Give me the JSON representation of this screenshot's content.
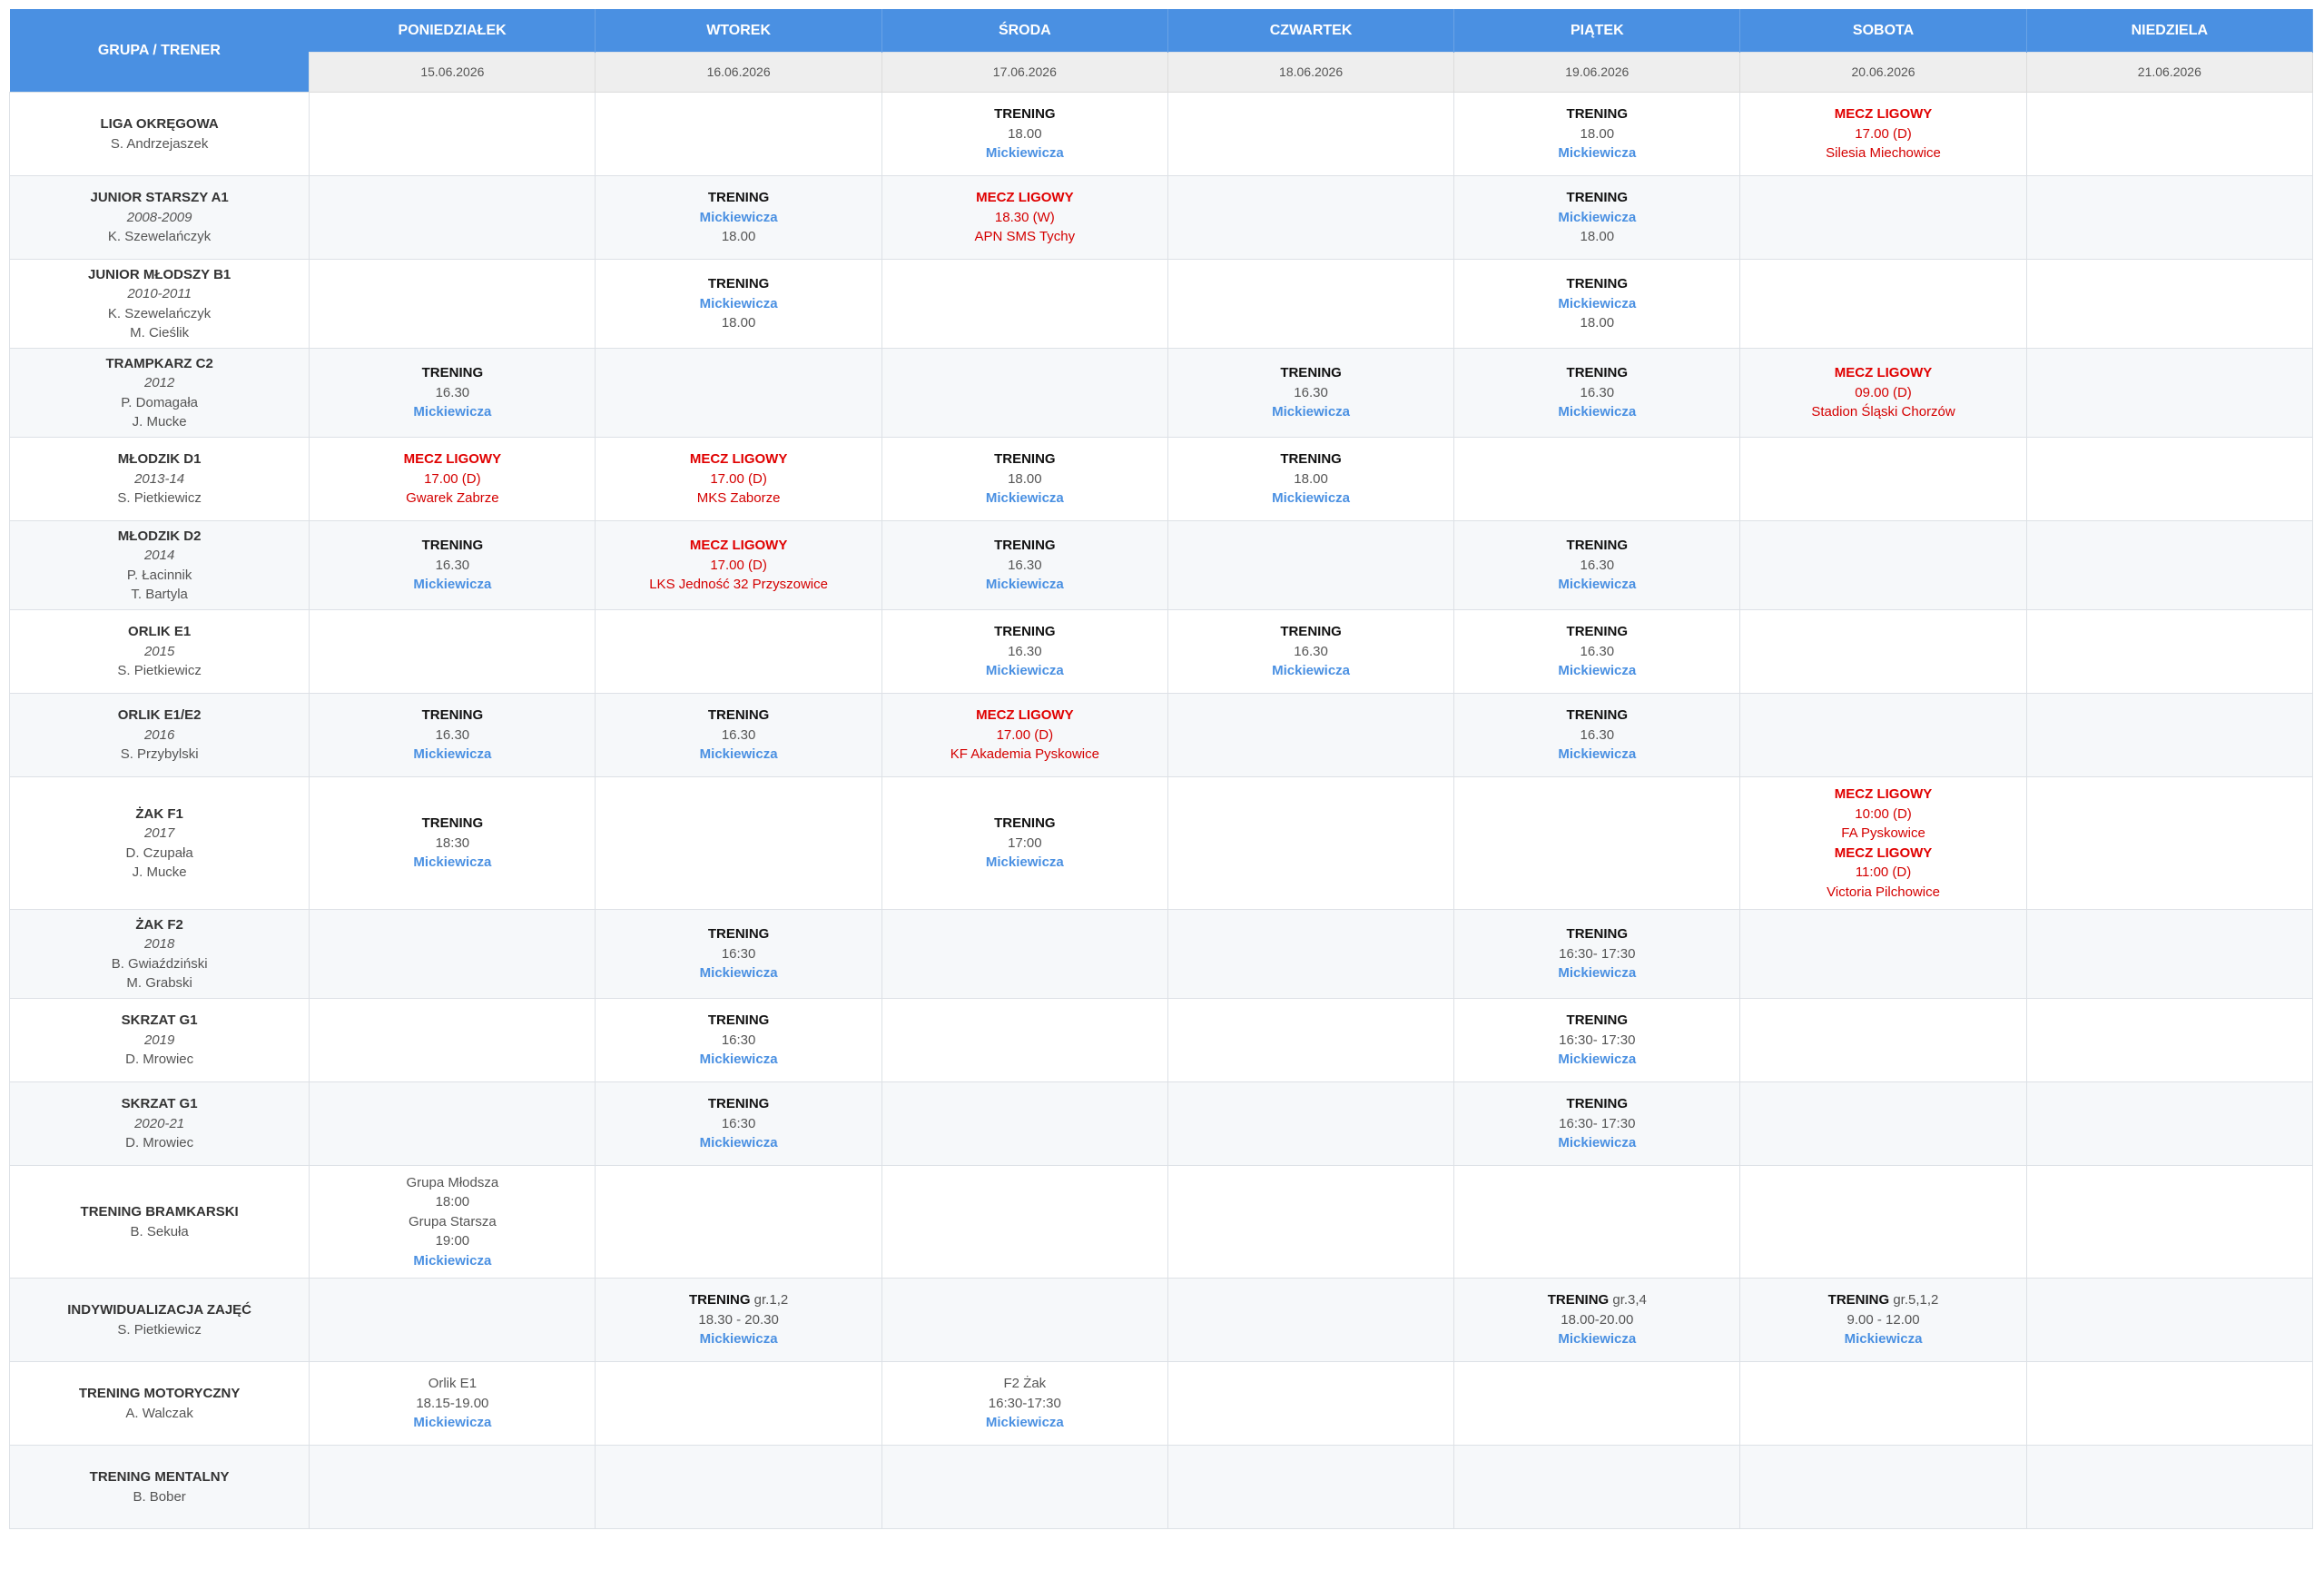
{
  "header": {
    "group_trainer": "GRUPA / TRENER",
    "days": [
      {
        "name": "PONIEDZIAŁEK",
        "date": "15.06.2026"
      },
      {
        "name": "WTOREK",
        "date": "16.06.2026"
      },
      {
        "name": "ŚRODA",
        "date": "17.06.2026"
      },
      {
        "name": "CZWARTEK",
        "date": "18.06.2026"
      },
      {
        "name": "PIĄTEK",
        "date": "19.06.2026"
      },
      {
        "name": "SOBOTA",
        "date": "20.06.2026"
      },
      {
        "name": "NIEDZIELA",
        "date": "21.06.2026"
      }
    ]
  },
  "labels": {
    "training": "TRENING",
    "league_match": "MECZ LIGOWY",
    "location": "Mickiewicza"
  },
  "colors": {
    "header_blue": "#4a90e2",
    "match_red": "#e00000",
    "location_blue": "#4a90e2"
  },
  "rows": [
    {
      "group": {
        "name": "LIGA OKRĘGOWA",
        "year": "",
        "coaches": [
          "S. Andrzejaszek"
        ]
      },
      "height": 92,
      "cells": [
        [],
        [],
        [
          {
            "kind": "training",
            "lines": [
              "18.00"
            ],
            "loc": true
          }
        ],
        [],
        [
          {
            "kind": "training",
            "lines": [
              "18.00"
            ],
            "loc": true
          }
        ],
        [
          {
            "kind": "match",
            "lines": [
              "17.00 (D)",
              "Silesia Miechowice"
            ]
          }
        ],
        []
      ]
    },
    {
      "group": {
        "name": "JUNIOR STARSZY A1",
        "year": "2008-2009",
        "coaches": [
          "K. Szewelańczyk"
        ]
      },
      "height": 92,
      "cells": [
        [],
        [
          {
            "kind": "training",
            "loc_first": true,
            "lines": [
              "18.00"
            ]
          }
        ],
        [
          {
            "kind": "match",
            "lines": [
              "18.30 (W)",
              "APN SMS Tychy"
            ]
          }
        ],
        [],
        [
          {
            "kind": "training",
            "loc_first": true,
            "lines": [
              "18.00"
            ]
          }
        ],
        [],
        []
      ]
    },
    {
      "group": {
        "name": "JUNIOR MŁODSZY B1",
        "year": "2010-2011",
        "coaches": [
          "K. Szewelańczyk",
          "M. Cieślik"
        ]
      },
      "height": 98,
      "cells": [
        [],
        [
          {
            "kind": "training",
            "loc_first": true,
            "lines": [
              "18.00"
            ]
          }
        ],
        [],
        [],
        [
          {
            "kind": "training",
            "loc_first": true,
            "lines": [
              "18.00"
            ]
          }
        ],
        [],
        []
      ]
    },
    {
      "group": {
        "name": "TRAMPKARZ C2",
        "year": "2012",
        "coaches": [
          "P. Domagała",
          "J. Mucke"
        ]
      },
      "height": 98,
      "cells": [
        [
          {
            "kind": "training",
            "lines": [
              "16.30"
            ],
            "loc": true
          }
        ],
        [],
        [],
        [
          {
            "kind": "training",
            "lines": [
              "16.30"
            ],
            "loc": true
          }
        ],
        [
          {
            "kind": "training",
            "lines": [
              "16.30"
            ],
            "loc": true
          }
        ],
        [
          {
            "kind": "match",
            "lines": [
              "09.00 (D)",
              "Stadion Śląski Chorzów"
            ]
          }
        ],
        []
      ]
    },
    {
      "group": {
        "name": "MŁODZIK D1",
        "year": "2013-14",
        "coaches": [
          "S. Pietkiewicz"
        ]
      },
      "height": 92,
      "cells": [
        [
          {
            "kind": "match",
            "lines": [
              "17.00 (D)",
              "Gwarek Zabrze"
            ]
          }
        ],
        [
          {
            "kind": "match",
            "lines": [
              "17.00 (D)",
              "MKS Zaborze"
            ]
          }
        ],
        [
          {
            "kind": "training",
            "lines": [
              "18.00"
            ],
            "loc": true
          }
        ],
        [
          {
            "kind": "training",
            "lines": [
              "18.00"
            ],
            "loc": true
          }
        ],
        [],
        [],
        []
      ]
    },
    {
      "group": {
        "name": "MŁODZIK D2",
        "year": "2014",
        "coaches": [
          "P. Łacinnik",
          "T. Bartyla"
        ]
      },
      "height": 98,
      "cells": [
        [
          {
            "kind": "training",
            "lines": [
              "16.30"
            ],
            "loc": true
          }
        ],
        [
          {
            "kind": "match",
            "lines": [
              "17.00 (D)",
              "LKS Jedność 32 Przyszowice"
            ]
          }
        ],
        [
          {
            "kind": "training",
            "lines": [
              "16.30"
            ],
            "loc": true
          }
        ],
        [],
        [
          {
            "kind": "training",
            "lines": [
              "16.30"
            ],
            "loc": true
          }
        ],
        [],
        []
      ]
    },
    {
      "group": {
        "name": "ORLIK E1",
        "year": "2015",
        "coaches": [
          "S. Pietkiewicz"
        ]
      },
      "height": 92,
      "cells": [
        [],
        [],
        [
          {
            "kind": "training",
            "lines": [
              "16.30"
            ],
            "loc": true
          }
        ],
        [
          {
            "kind": "training",
            "lines": [
              "16.30"
            ],
            "loc": true
          }
        ],
        [
          {
            "kind": "training",
            "lines": [
              "16.30"
            ],
            "loc": true
          }
        ],
        [],
        []
      ]
    },
    {
      "group": {
        "name": "ORLIK E1/E2",
        "year": "2016",
        "coaches": [
          "S. Przybylski"
        ]
      },
      "height": 92,
      "cells": [
        [
          {
            "kind": "training",
            "lines": [
              "16.30"
            ],
            "loc": true
          }
        ],
        [
          {
            "kind": "training",
            "lines": [
              "16.30"
            ],
            "loc": true
          }
        ],
        [
          {
            "kind": "match",
            "lines": [
              "17.00 (D)",
              "KF Akademia Pyskowice"
            ]
          }
        ],
        [],
        [
          {
            "kind": "training",
            "lines": [
              "16.30"
            ],
            "loc": true
          }
        ],
        [],
        []
      ]
    },
    {
      "group": {
        "name": "ŻAK F1",
        "year": "2017",
        "coaches": [
          "D. Czupała",
          "J. Mucke"
        ]
      },
      "height": 146,
      "cells": [
        [
          {
            "kind": "training",
            "lines": [
              "18:30"
            ],
            "loc": true
          }
        ],
        [],
        [
          {
            "kind": "training",
            "lines": [
              "17:00"
            ],
            "loc": true
          }
        ],
        [],
        [],
        [
          {
            "kind": "match",
            "lines": [
              "10:00 (D)",
              "FA Pyskowice"
            ]
          },
          {
            "kind": "match",
            "lines": [
              "11:00 (D)",
              "Victoria Pilchowice"
            ]
          }
        ],
        []
      ]
    },
    {
      "group": {
        "name": "ŻAK F2",
        "year": "2018",
        "coaches": [
          "B. Gwiaździński",
          "M. Grabski"
        ]
      },
      "height": 98,
      "cells": [
        [],
        [
          {
            "kind": "training",
            "lines": [
              "16:30"
            ],
            "loc": true
          }
        ],
        [],
        [],
        [
          {
            "kind": "training",
            "lines": [
              "16:30- 17:30"
            ],
            "loc": true
          }
        ],
        [],
        []
      ]
    },
    {
      "group": {
        "name": "SKRZAT G1",
        "year": "2019",
        "coaches": [
          "D. Mrowiec"
        ]
      },
      "height": 92,
      "cells": [
        [],
        [
          {
            "kind": "training",
            "lines": [
              "16:30"
            ],
            "loc": true
          }
        ],
        [],
        [],
        [
          {
            "kind": "training",
            "lines": [
              "16:30- 17:30"
            ],
            "loc": true
          }
        ],
        [],
        []
      ]
    },
    {
      "group": {
        "name": "SKRZAT G1",
        "year": "2020-21",
        "coaches": [
          "D. Mrowiec"
        ]
      },
      "height": 92,
      "cells": [
        [],
        [
          {
            "kind": "training",
            "lines": [
              "16:30"
            ],
            "loc": true
          }
        ],
        [],
        [],
        [
          {
            "kind": "training",
            "lines": [
              "16:30- 17:30"
            ],
            "loc": true
          }
        ],
        [],
        []
      ]
    },
    {
      "group": {
        "name": "TRENING BRAMKARSKI",
        "year": "",
        "coaches": [
          "B. Sekuła"
        ]
      },
      "height": 124,
      "cells": [
        [
          {
            "kind": "plain",
            "lines": [
              "Grupa Młodsza",
              "18:00",
              "Grupa Starsza",
              "19:00"
            ],
            "loc": true
          }
        ],
        [],
        [],
        [],
        [],
        [],
        []
      ]
    },
    {
      "group": {
        "name": "INDYWIDUALIZACJA ZAJĘĆ",
        "year": "",
        "coaches": [
          "S. Pietkiewicz"
        ]
      },
      "height": 92,
      "cells": [
        [],
        [
          {
            "kind": "training",
            "suffix": "gr.1,2",
            "lines": [
              "18.30 - 20.30"
            ],
            "loc": true
          }
        ],
        [],
        [],
        [
          {
            "kind": "training",
            "suffix": "gr.3,4",
            "lines": [
              "18.00-20.00"
            ],
            "loc": true
          }
        ],
        [
          {
            "kind": "training",
            "suffix": "gr.5,1,2",
            "lines": [
              "9.00 - 12.00"
            ],
            "loc": true
          }
        ],
        []
      ]
    },
    {
      "group": {
        "name": "TRENING MOTORYCZNY",
        "year": "",
        "coaches": [
          "A. Walczak"
        ]
      },
      "height": 92,
      "cells": [
        [
          {
            "kind": "plain",
            "lines": [
              "Orlik E1",
              "18.15-19.00"
            ],
            "loc": true
          }
        ],
        [],
        [
          {
            "kind": "plain",
            "lines": [
              "F2 Żak",
              "16:30-17:30"
            ],
            "loc": true
          }
        ],
        [],
        [],
        [],
        []
      ]
    },
    {
      "group": {
        "name": "TRENING MENTALNY",
        "year": "",
        "coaches": [
          "B. Bober"
        ]
      },
      "height": 92,
      "cells": [
        [],
        [],
        [],
        [],
        [],
        [],
        []
      ]
    }
  ]
}
